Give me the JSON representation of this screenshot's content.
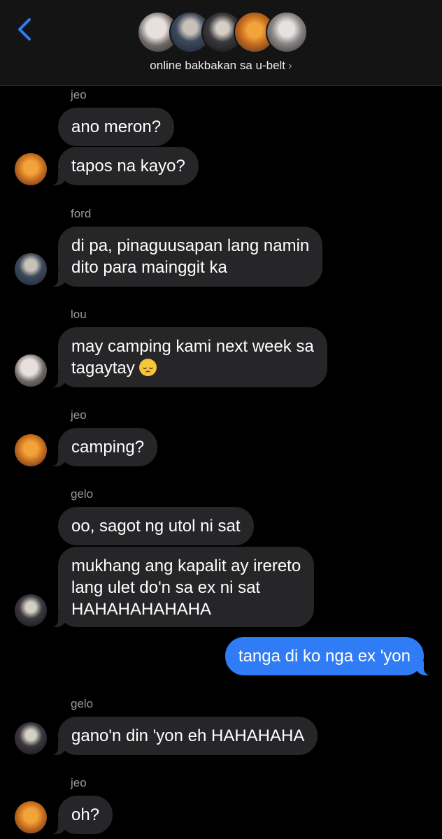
{
  "header": {
    "back_icon": "chevron-left-icon",
    "group_name": "online bakbakan sa u-belt",
    "group_chevron": "›",
    "accent": "#2f7cf6"
  },
  "messages": [
    {
      "sender": "jeo",
      "lines": [
        "ano meron?"
      ]
    },
    {
      "lines": [
        "tapos na kayo?"
      ]
    },
    {
      "sender": "ford",
      "lines": [
        "di pa, pinaguusapan lang namin",
        "dito para mainggit ka"
      ]
    },
    {
      "sender": "lou",
      "lines": [
        "may camping kami next week sa",
        "tagaytay"
      ],
      "emoji": "pensive-face-emoji"
    },
    {
      "sender": "jeo",
      "lines": [
        "camping?"
      ]
    },
    {
      "sender": "gelo",
      "lines": [
        "oo, sagot ng utol ni sat"
      ]
    },
    {
      "lines": [
        "mukhang ang kapalit ay irereto",
        "lang ulet do'n sa ex ni sat",
        "HAHAHAHAHAHA"
      ]
    },
    {
      "outgoing": true,
      "lines": [
        "tanga di ko nga ex 'yon"
      ]
    },
    {
      "sender": "gelo",
      "lines": [
        "gano'n din 'yon eh HAHAHAHA"
      ]
    },
    {
      "sender": "jeo",
      "lines": [
        "oh?"
      ]
    }
  ],
  "colors": {
    "incoming_bubble": "#262628",
    "outgoing_bubble": "#2f7cf6",
    "sender_label": "#98989d"
  }
}
